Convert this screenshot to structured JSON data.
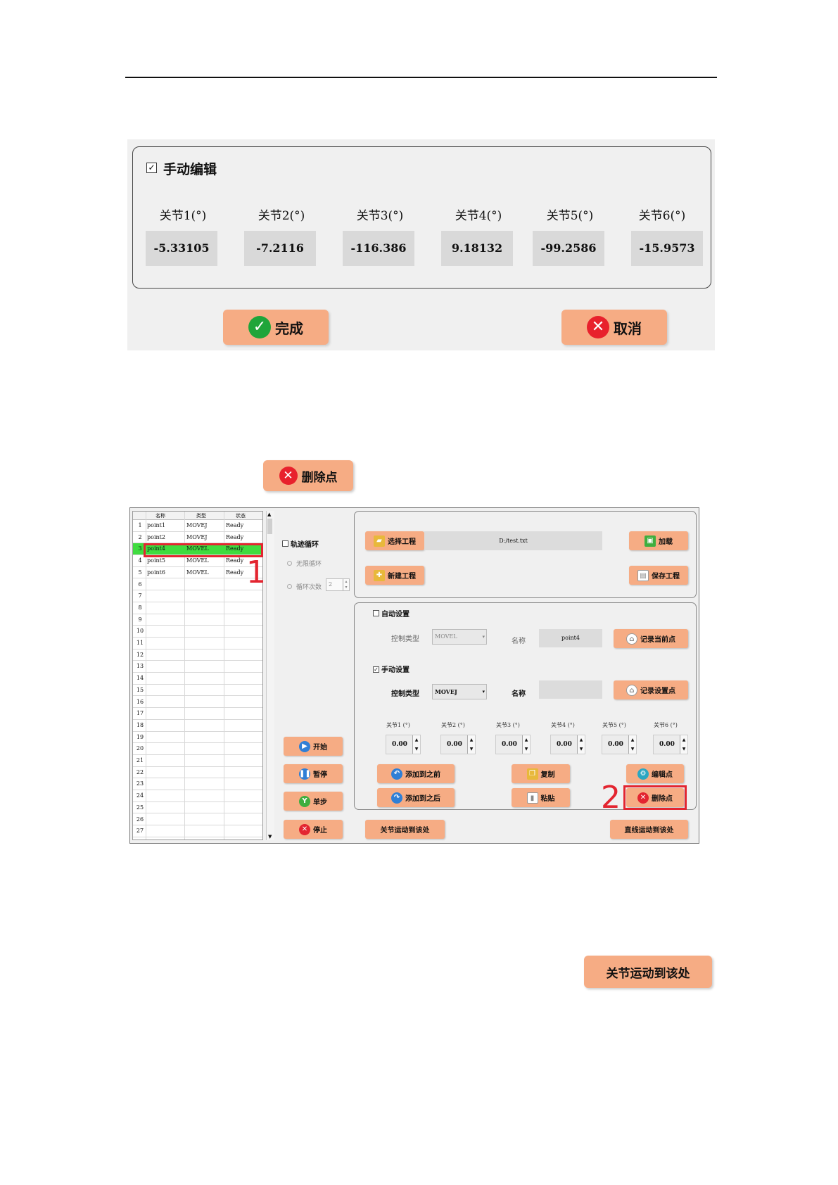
{
  "manual_edit": {
    "check": "☑",
    "title": "手动编辑",
    "joints": [
      {
        "label": "关节1(°)",
        "value": "-5.33105"
      },
      {
        "label": "关节2(°)",
        "value": "-7.2116"
      },
      {
        "label": "关节3(°)",
        "value": "-116.386"
      },
      {
        "label": "关节4(°)",
        "value": "9.18132"
      },
      {
        "label": "关节5(°)",
        "value": "-99.2586"
      },
      {
        "label": "关节6(°)",
        "value": "-15.9573"
      }
    ],
    "done_label": "完成",
    "cancel_label": "取消",
    "colors": {
      "button": "#f6ac84",
      "ok": "#1fa53a",
      "cancel": "#e32530"
    }
  },
  "delete_point_label": "删除点",
  "main": {
    "table": {
      "headers": [
        "名称",
        "类型",
        "状态"
      ],
      "rows": [
        {
          "n": "1",
          "name": "point1",
          "type": "MOVEJ",
          "status": "Ready"
        },
        {
          "n": "2",
          "name": "point2",
          "type": "MOVEJ",
          "status": "Ready"
        },
        {
          "n": "3",
          "name": "point4",
          "type": "MOVEL",
          "status": "Ready"
        },
        {
          "n": "4",
          "name": "point5",
          "type": "MOVEL",
          "status": "Ready"
        },
        {
          "n": "5",
          "name": "point6",
          "type": "MOVEL",
          "status": "Ready"
        }
      ],
      "empty_rows": [
        "6",
        "7",
        "8",
        "9",
        "10",
        "11",
        "12",
        "13",
        "14",
        "15",
        "16",
        "17",
        "18",
        "19",
        "20",
        "21",
        "22",
        "23",
        "24",
        "25",
        "26",
        "27"
      ],
      "selected_color": "#3fdc3f"
    },
    "callout_1": "1",
    "callout_2": "2",
    "loop": {
      "title": "轨迹循环",
      "infinite": "无限循环",
      "count_label": "循环次数",
      "count_value": "2"
    },
    "project": {
      "select": "选择工程",
      "path": "D:/test.txt",
      "load": "加载",
      "new": "新建工程",
      "save": "保存工程"
    },
    "auto": {
      "title": "自动设置",
      "ctrl_type_label": "控制类型",
      "ctrl_type_value": "MOVEL",
      "name_label": "名称",
      "name_value": "point4",
      "record": "记录当前点"
    },
    "manual": {
      "title": "手动设置",
      "ctrl_type_label": "控制类型",
      "ctrl_type_value": "MOVEJ",
      "name_label": "名称",
      "name_value": "",
      "record": "记录设置点"
    },
    "joints": [
      {
        "label": "关节1 (°)",
        "value": "0.00"
      },
      {
        "label": "关节2 (°)",
        "value": "0.00"
      },
      {
        "label": "关节3 (°)",
        "value": "0.00"
      },
      {
        "label": "关节4 (°)",
        "value": "0.00"
      },
      {
        "label": "关节5 (°)",
        "value": "0.00"
      },
      {
        "label": "关节6 (°)",
        "value": "0.00"
      }
    ],
    "actions": {
      "add_before": "添加到之前",
      "add_after": "添加到之后",
      "copy": "复制",
      "paste": "粘贴",
      "edit": "编辑点",
      "delete": "删除点"
    },
    "run": {
      "start": "开始",
      "pause": "暂停",
      "step": "单步",
      "stop": "停止"
    },
    "joint_move": "关节运动到该处",
    "line_move": "直线运动到该处"
  },
  "joint_move_label": "关节运动到该处"
}
